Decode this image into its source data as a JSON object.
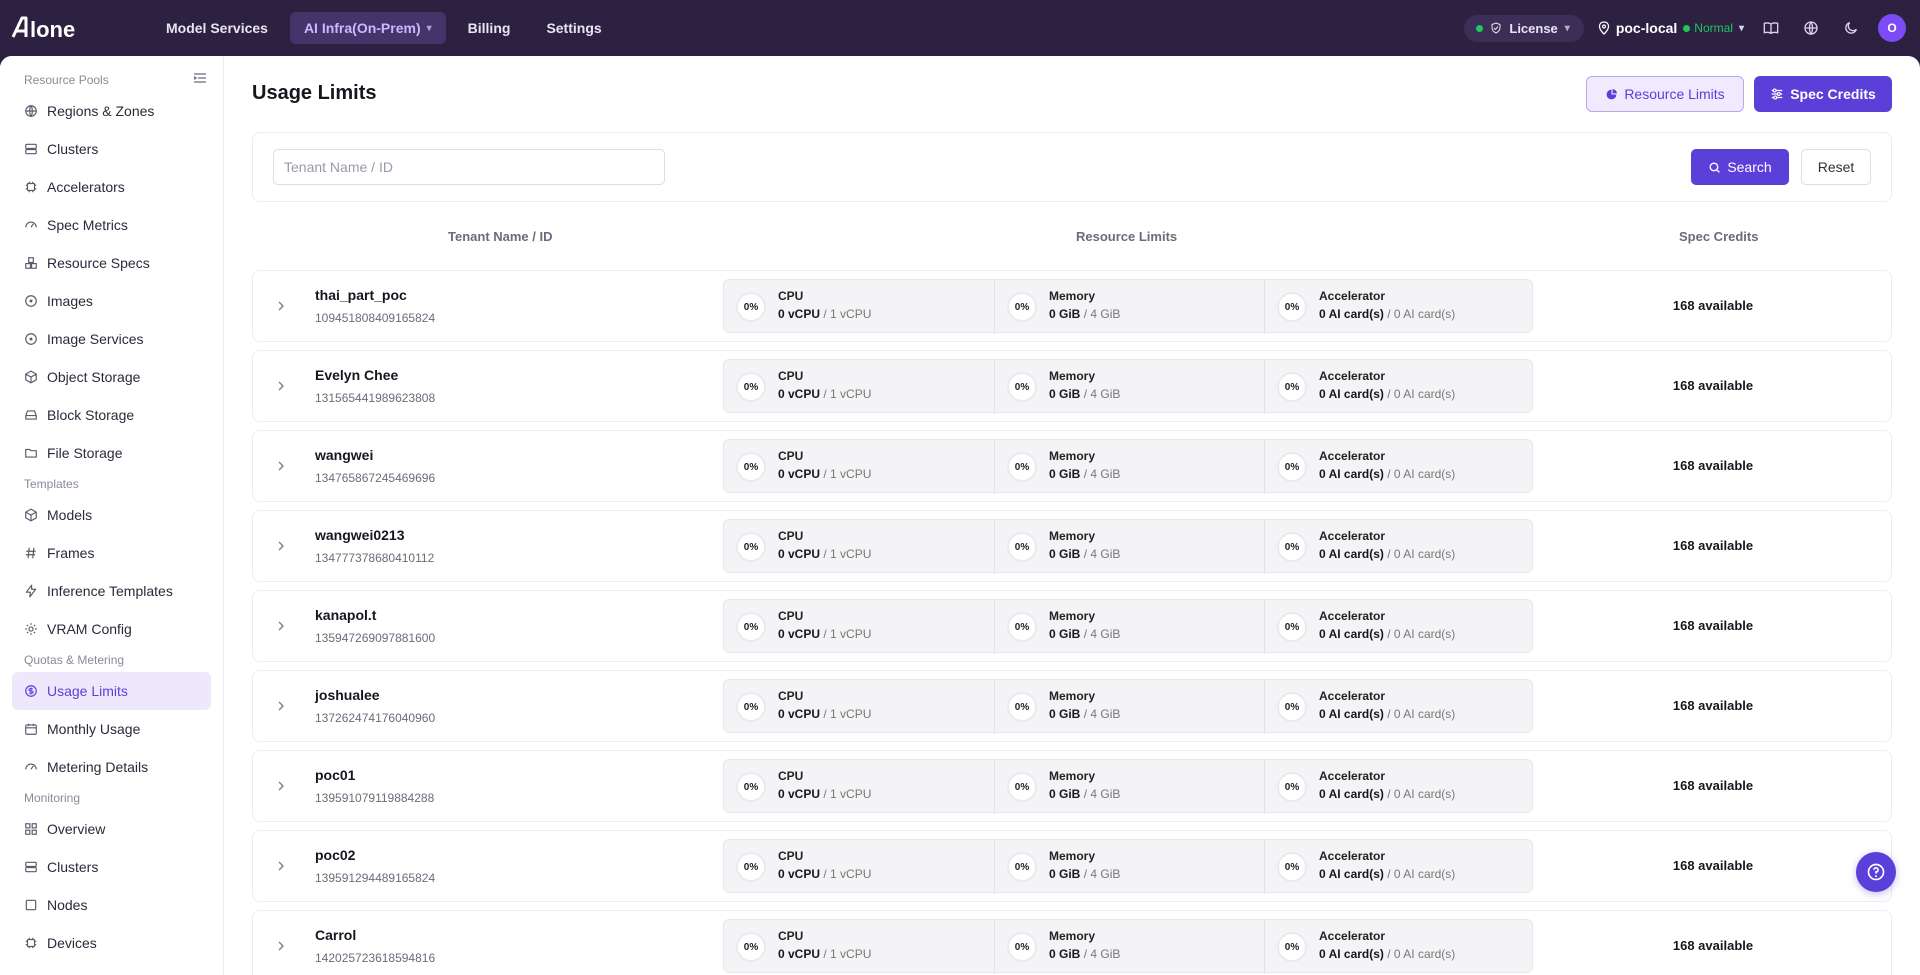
{
  "brand": {
    "logo_text": "Alone",
    "accent": "#5b3fd9",
    "topbar_bg": "#2d2142"
  },
  "nav": [
    {
      "label": "Model Services"
    },
    {
      "label": "AI Infra(On-Prem)",
      "active": true
    },
    {
      "label": "Billing"
    },
    {
      "label": "Settings"
    }
  ],
  "topbar": {
    "license_label": "License",
    "region_name": "poc-local",
    "region_status": "Normal",
    "avatar_initial": "O"
  },
  "sidebar": {
    "sections": [
      {
        "label": "Resource Pools",
        "items": [
          {
            "label": "Regions & Zones",
            "icon": "globe-icon"
          },
          {
            "label": "Clusters",
            "icon": "server-icon"
          },
          {
            "label": "Accelerators",
            "icon": "chip-icon"
          },
          {
            "label": "Spec Metrics",
            "icon": "gauge-icon"
          },
          {
            "label": "Resource Specs",
            "icon": "boxes-icon"
          },
          {
            "label": "Images",
            "icon": "disc-icon"
          },
          {
            "label": "Image Services",
            "icon": "disc-icon"
          },
          {
            "label": "Object Storage",
            "icon": "cube-icon"
          },
          {
            "label": "Block Storage",
            "icon": "drive-icon"
          },
          {
            "label": "File Storage",
            "icon": "folder-icon"
          }
        ]
      },
      {
        "label": "Templates",
        "items": [
          {
            "label": "Models",
            "icon": "cube-icon"
          },
          {
            "label": "Frames",
            "icon": "hash-icon"
          },
          {
            "label": "Inference Templates",
            "icon": "bolt-icon"
          },
          {
            "label": "VRAM Config",
            "icon": "gear-icon"
          }
        ]
      },
      {
        "label": "Quotas & Metering",
        "items": [
          {
            "label": "Usage Limits",
            "icon": "coin-icon",
            "active": true
          },
          {
            "label": "Monthly Usage",
            "icon": "calendar-icon"
          },
          {
            "label": "Metering Details",
            "icon": "gauge-icon"
          }
        ]
      },
      {
        "label": "Monitoring",
        "items": [
          {
            "label": "Overview",
            "icon": "grid-icon"
          },
          {
            "label": "Clusters",
            "icon": "server-icon"
          },
          {
            "label": "Nodes",
            "icon": "square-icon"
          },
          {
            "label": "Devices",
            "icon": "chip-icon"
          }
        ]
      }
    ]
  },
  "page": {
    "title": "Usage Limits",
    "resource_limits_btn": "Resource Limits",
    "spec_credits_btn": "Spec Credits",
    "search_placeholder": "Tenant Name / ID",
    "search_btn": "Search",
    "reset_btn": "Reset"
  },
  "table": {
    "headers": {
      "tenant": "Tenant Name / ID",
      "limits": "Resource Limits",
      "credits": "Spec Credits"
    },
    "rows": [
      {
        "name": "thai_part_poc",
        "id": "109451808409165824",
        "cpu_pct": "0%",
        "cpu_used": "0 vCPU",
        "cpu_total": "/ 1 vCPU",
        "mem_pct": "0%",
        "mem_used": "0 GiB",
        "mem_total": "/ 4 GiB",
        "acc_pct": "0%",
        "acc_used": "0 AI card(s)",
        "acc_total": "/ 0 AI card(s)",
        "credits": "168 available"
      },
      {
        "name": "Evelyn Chee",
        "id": "131565441989623808",
        "cpu_pct": "0%",
        "cpu_used": "0 vCPU",
        "cpu_total": "/ 1 vCPU",
        "mem_pct": "0%",
        "mem_used": "0 GiB",
        "mem_total": "/ 4 GiB",
        "acc_pct": "0%",
        "acc_used": "0 AI card(s)",
        "acc_total": "/ 0 AI card(s)",
        "credits": "168 available"
      },
      {
        "name": "wangwei",
        "id": "134765867245469696",
        "cpu_pct": "0%",
        "cpu_used": "0 vCPU",
        "cpu_total": "/ 1 vCPU",
        "mem_pct": "0%",
        "mem_used": "0 GiB",
        "mem_total": "/ 4 GiB",
        "acc_pct": "0%",
        "acc_used": "0 AI card(s)",
        "acc_total": "/ 0 AI card(s)",
        "credits": "168 available"
      },
      {
        "name": "wangwei0213",
        "id": "134777378680410112",
        "cpu_pct": "0%",
        "cpu_used": "0 vCPU",
        "cpu_total": "/ 1 vCPU",
        "mem_pct": "0%",
        "mem_used": "0 GiB",
        "mem_total": "/ 4 GiB",
        "acc_pct": "0%",
        "acc_used": "0 AI card(s)",
        "acc_total": "/ 0 AI card(s)",
        "credits": "168 available"
      },
      {
        "name": "kanapol.t",
        "id": "135947269097881600",
        "cpu_pct": "0%",
        "cpu_used": "0 vCPU",
        "cpu_total": "/ 1 vCPU",
        "mem_pct": "0%",
        "mem_used": "0 GiB",
        "mem_total": "/ 4 GiB",
        "acc_pct": "0%",
        "acc_used": "0 AI card(s)",
        "acc_total": "/ 0 AI card(s)",
        "credits": "168 available"
      },
      {
        "name": "joshualee",
        "id": "137262474176040960",
        "cpu_pct": "0%",
        "cpu_used": "0 vCPU",
        "cpu_total": "/ 1 vCPU",
        "mem_pct": "0%",
        "mem_used": "0 GiB",
        "mem_total": "/ 4 GiB",
        "acc_pct": "0%",
        "acc_used": "0 AI card(s)",
        "acc_total": "/ 0 AI card(s)",
        "credits": "168 available"
      },
      {
        "name": "poc01",
        "id": "139591079119884288",
        "cpu_pct": "0%",
        "cpu_used": "0 vCPU",
        "cpu_total": "/ 1 vCPU",
        "mem_pct": "0%",
        "mem_used": "0 GiB",
        "mem_total": "/ 4 GiB",
        "acc_pct": "0%",
        "acc_used": "0 AI card(s)",
        "acc_total": "/ 0 AI card(s)",
        "credits": "168 available"
      },
      {
        "name": "poc02",
        "id": "139591294489165824",
        "cpu_pct": "0%",
        "cpu_used": "0 vCPU",
        "cpu_total": "/ 1 vCPU",
        "mem_pct": "0%",
        "mem_used": "0 GiB",
        "mem_total": "/ 4 GiB",
        "acc_pct": "0%",
        "acc_used": "0 AI card(s)",
        "acc_total": "/ 0 AI card(s)",
        "credits": "168 available"
      },
      {
        "name": "Carrol",
        "id": "142025723618594816",
        "cpu_pct": "0%",
        "cpu_used": "0 vCPU",
        "cpu_total": "/ 1 vCPU",
        "mem_pct": "0%",
        "mem_used": "0 GiB",
        "mem_total": "/ 4 GiB",
        "acc_pct": "0%",
        "acc_used": "0 AI card(s)",
        "acc_total": "/ 0 AI card(s)",
        "credits": "168 available"
      }
    ]
  }
}
